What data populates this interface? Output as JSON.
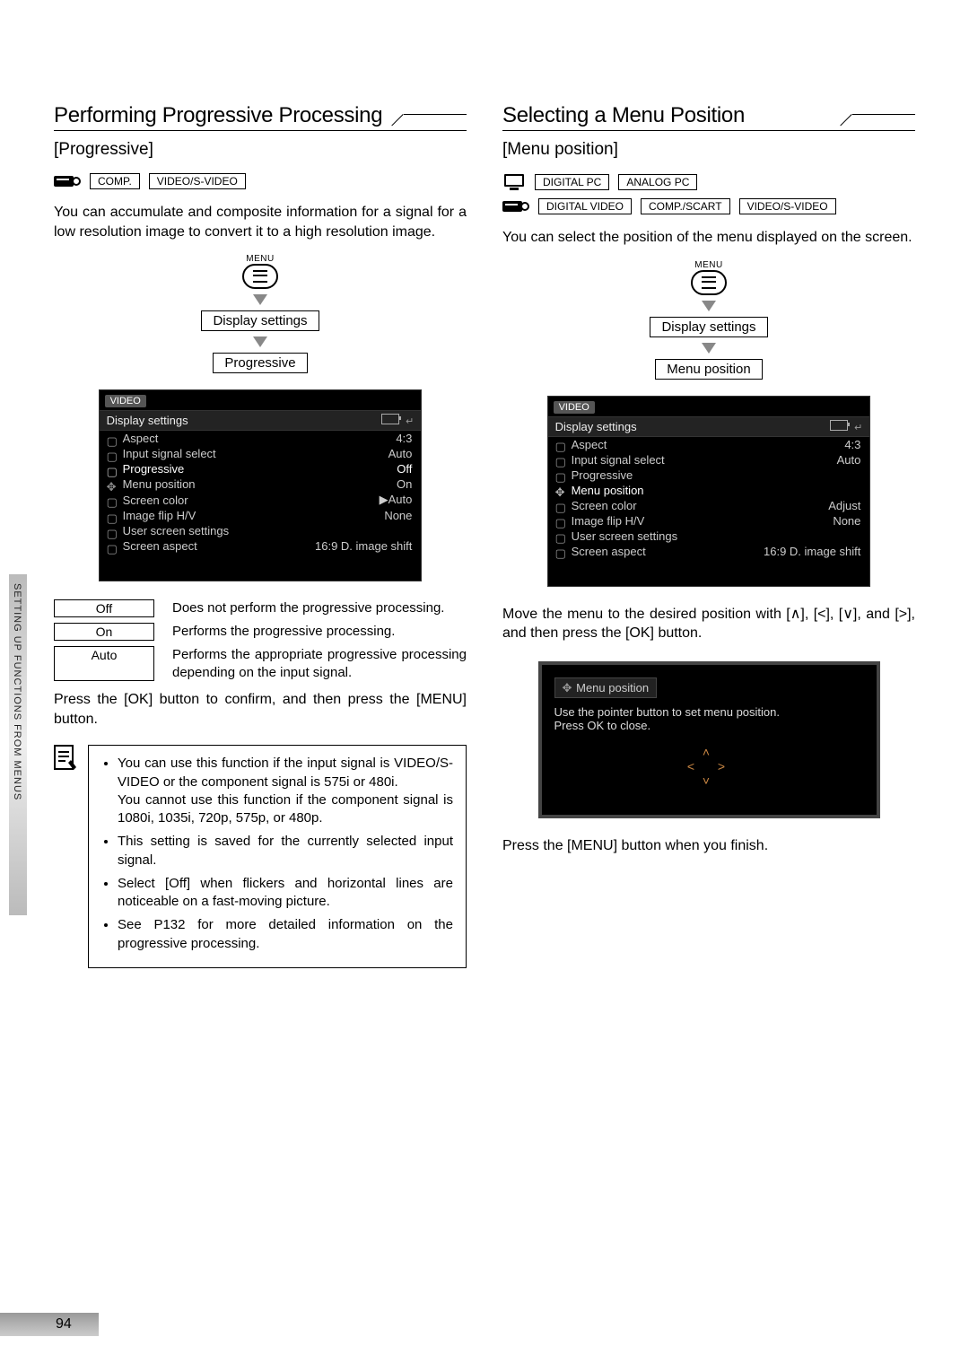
{
  "sidebar_label": "SETTING UP FUNCTIONS FROM MENUS",
  "page_number": "94",
  "left": {
    "title": "Performing Progressive Processing",
    "subtitle": "[Progressive]",
    "badges": [
      "COMP.",
      "VIDEO/S-VIDEO"
    ],
    "intro": "You can accumulate and composite information for a signal for a low resolution image to convert it to a high resolution image.",
    "menu_label": "MENU",
    "path": [
      "Display settings",
      "Progressive"
    ],
    "osd": {
      "tab": "VIDEO",
      "header": "Display settings",
      "rows": [
        {
          "label": "Aspect",
          "value": "4:3"
        },
        {
          "label": "Input signal select",
          "value": "Auto"
        },
        {
          "label": "Progressive",
          "value": "Off"
        },
        {
          "label": "Menu position",
          "value": "On"
        },
        {
          "label": "Screen color",
          "value": "▶Auto"
        },
        {
          "label": "Image flip H/V",
          "value": "None"
        },
        {
          "label": "User screen settings",
          "value": ""
        },
        {
          "label": "Screen aspect",
          "value": "16:9 D. image shift"
        }
      ]
    },
    "options": [
      {
        "name": "Off",
        "desc": "Does not perform the progressive processing."
      },
      {
        "name": "On",
        "desc": "Performs the progressive processing."
      },
      {
        "name": "Auto",
        "desc": "Performs the appropriate progressive processing depending on the input signal."
      }
    ],
    "press_ok": "Press the [OK] button to confirm, and then press the [MENU] button.",
    "notes": [
      "You can use this function if the input signal is VIDEO/S-VIDEO or the component signal is 575i or 480i.\nYou cannot use this function if the component signal is 1080i, 1035i, 720p, 575p, or 480p.",
      "This setting is saved for the currently selected input signal.",
      "Select [Off] when flickers and horizontal lines are noticeable on a fast-moving picture.",
      "See P132 for more detailed information on the progressive processing."
    ]
  },
  "right": {
    "title": "Selecting a Menu Position",
    "subtitle": "[Menu position]",
    "badges_top": [
      "DIGITAL PC",
      "ANALOG PC"
    ],
    "badges_bottom": [
      "DIGITAL VIDEO",
      "COMP./SCART",
      "VIDEO/S-VIDEO"
    ],
    "intro": "You can select the position of the menu displayed on the screen.",
    "menu_label": "MENU",
    "path": [
      "Display settings",
      "Menu position"
    ],
    "osd": {
      "tab": "VIDEO",
      "header": "Display settings",
      "rows": [
        {
          "label": "Aspect",
          "value": "4:3"
        },
        {
          "label": "Input signal select",
          "value": "Auto"
        },
        {
          "label": "Progressive",
          "value": ""
        },
        {
          "label": "Menu position",
          "value": ""
        },
        {
          "label": "Screen color",
          "value": "Adjust"
        },
        {
          "label": "Image flip H/V",
          "value": "None"
        },
        {
          "label": "User screen settings",
          "value": ""
        },
        {
          "label": "Screen aspect",
          "value": "16:9 D. image shift"
        }
      ]
    },
    "move_text": "Move the menu to the desired position with [∧], [<], [∨], and [>], and then press the [OK] button.",
    "popup": {
      "title": "Menu position",
      "line1": "Use the pointer button to set menu position.",
      "line2": "Press OK to close."
    },
    "press_menu": "Press the [MENU] button when you finish."
  }
}
